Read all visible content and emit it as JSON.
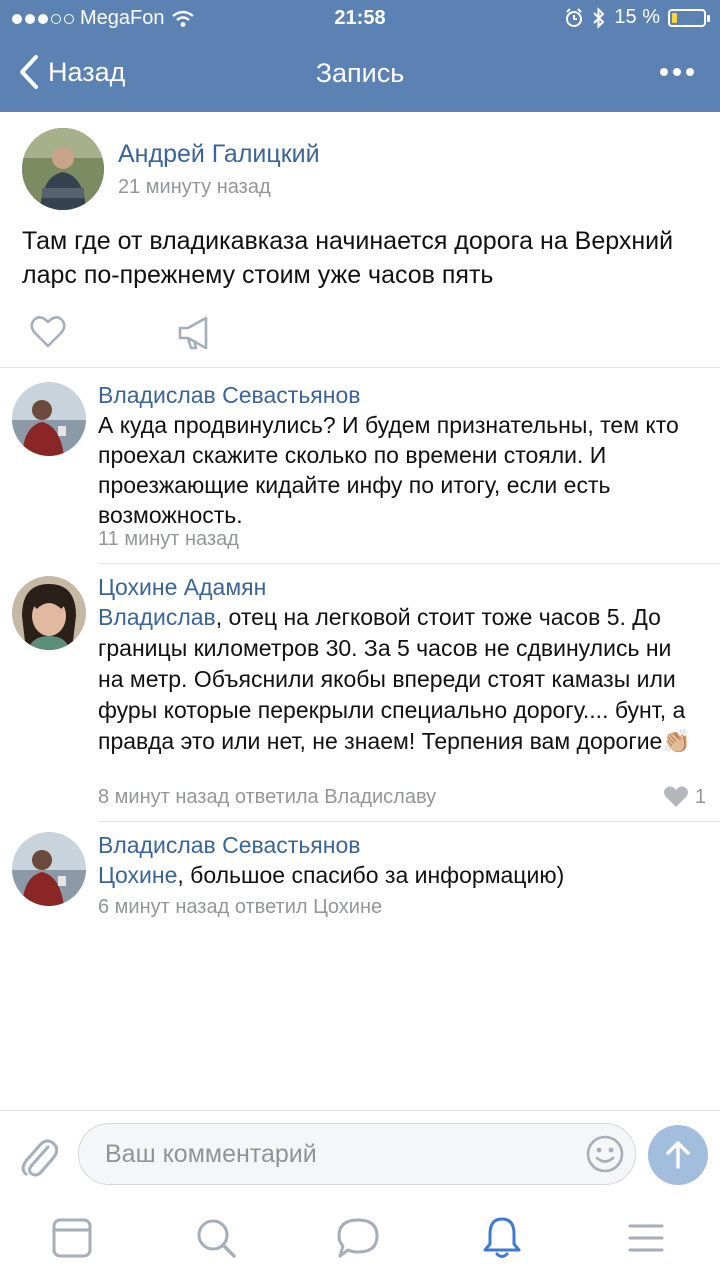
{
  "status_bar": {
    "carrier": "MegaFon",
    "time": "21:58",
    "battery": "15 %"
  },
  "nav": {
    "back_label": "Назад",
    "title": "Запись"
  },
  "post": {
    "author": "Андрей Галицкий",
    "time": "21 минуту назад",
    "text": "Там где от владикавказа начинается дорога на Верхний ларс по-прежнему стоим уже часов пять"
  },
  "comments": [
    {
      "author": "Владислав Севастьянов",
      "text": "А куда продвинулись? И будем признательны, тем кто проехал скажите сколько по времени стояли. И проезжающие кидайте инфу по итогу, если есть возможность.",
      "meta": "11 минут назад"
    },
    {
      "author": "Цохине Адамян",
      "mention": "Владислав",
      "text": ", отец на легковой стоит тоже часов 5. До границы километров 30. За 5 часов не сдвинулись ни на метр. Объяснили якобы впереди стоят камазы или фуры которые перекрыли специально дорогу.... бунт, а правда это или нет, не знаем! Терпения вам дорогие👏🏼",
      "meta": "8 минут назад ответила Владиславу",
      "likes": "1"
    },
    {
      "author": "Владислав Севастьянов",
      "mention": "Цохине",
      "text": ", большое спасибо за информацию)",
      "meta": "6 минут назад ответил Цохине"
    }
  ],
  "composer": {
    "placeholder": "Ваш комментарий"
  },
  "colors": {
    "header": "#5b82b3",
    "link": "#3b6497",
    "muted": "#939699",
    "send": "#a3bedc",
    "tab_active": "#3f7ad2",
    "tab_inactive": "#a6aeb8"
  },
  "icons": {
    "like": "heart-icon",
    "share": "megaphone-icon",
    "attach": "paperclip-icon",
    "emoji": "smiley-icon",
    "send": "arrow-up-icon",
    "tabs": [
      "news-icon",
      "search-icon",
      "messages-icon",
      "notifications-icon",
      "menu-icon"
    ]
  }
}
